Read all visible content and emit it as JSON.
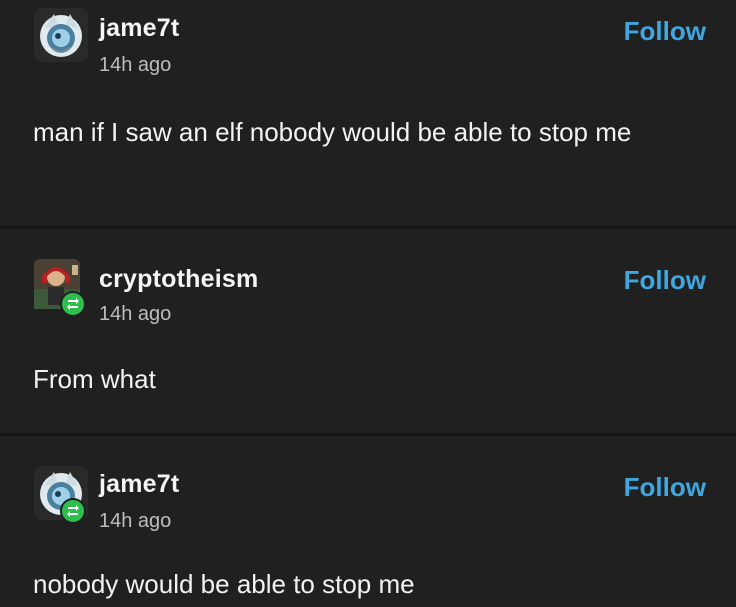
{
  "posts": [
    {
      "username": "jame7t",
      "time": "14h ago",
      "follow_label": "Follow",
      "text": "man if I saw an elf nobody would be able to stop me",
      "reblogged": false
    },
    {
      "username": "cryptotheism",
      "time": "14h ago",
      "follow_label": "Follow",
      "text": "From what",
      "reblogged": true
    },
    {
      "username": "jame7t",
      "time": "14h ago",
      "follow_label": "Follow",
      "text": "nobody would be able to stop me",
      "reblogged": true
    }
  ],
  "colors": {
    "background": "#202020",
    "follow": "#3fa6e0",
    "reblog_badge": "#2dbf4e"
  },
  "icons": {
    "avatar_jame7t": "blue-creature-avatar-icon",
    "avatar_cryptotheism": "man-with-headphones-avatar-icon",
    "reblog": "reblog-icon"
  }
}
